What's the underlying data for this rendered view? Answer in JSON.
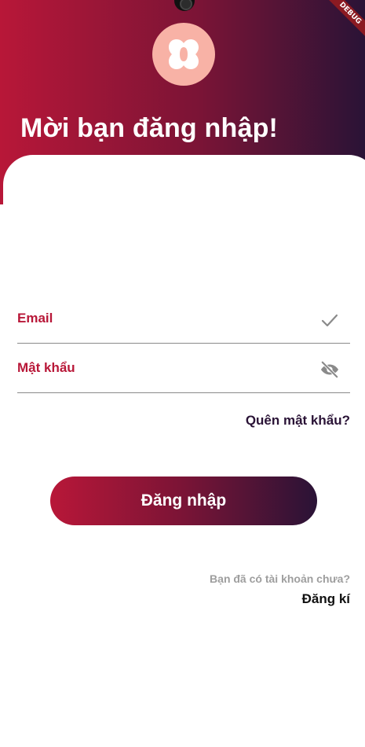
{
  "header": {
    "title": "Mời bạn đăng nhập!",
    "debug_banner": "DEBUG",
    "logo_icon": "app-logo-icon"
  },
  "form": {
    "email_label": "Email",
    "email_icon": "check-icon",
    "password_label": "Mật khẩu",
    "password_icon": "eye-off-icon",
    "forgot_password": "Quên mật khẩu?",
    "login_button": "Đăng nhập"
  },
  "footer": {
    "no_account": "Bạn đã có tài khoản chưa?",
    "register": "Đăng kí"
  },
  "colors": {
    "gradient_start": "#b81738",
    "gradient_end": "#2a1336",
    "label_accent": "#b81738",
    "logo_bg": "#f8b2a6"
  }
}
